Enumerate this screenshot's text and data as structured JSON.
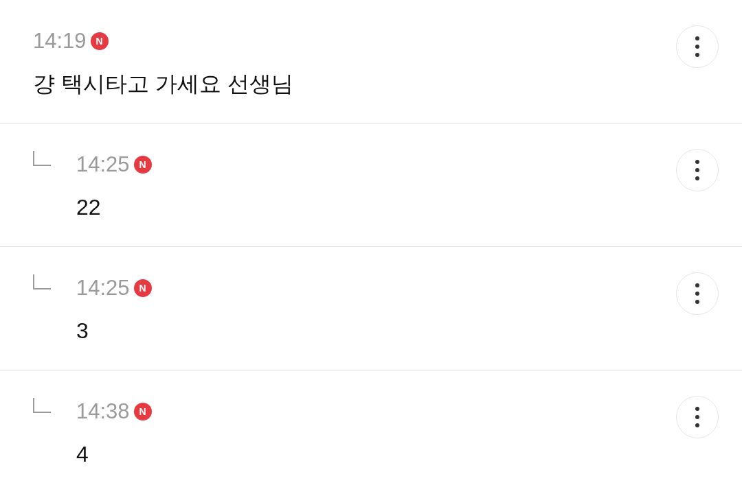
{
  "comments": [
    {
      "kind": "comment",
      "time": "14:19",
      "badge": "N",
      "text": "걍 택시타고 가세요 선생님"
    },
    {
      "kind": "reply",
      "time": "14:25",
      "badge": "N",
      "text": "22"
    },
    {
      "kind": "reply",
      "time": "14:25",
      "badge": "N",
      "text": "3"
    },
    {
      "kind": "reply",
      "time": "14:38",
      "badge": "N",
      "text": "4"
    }
  ]
}
